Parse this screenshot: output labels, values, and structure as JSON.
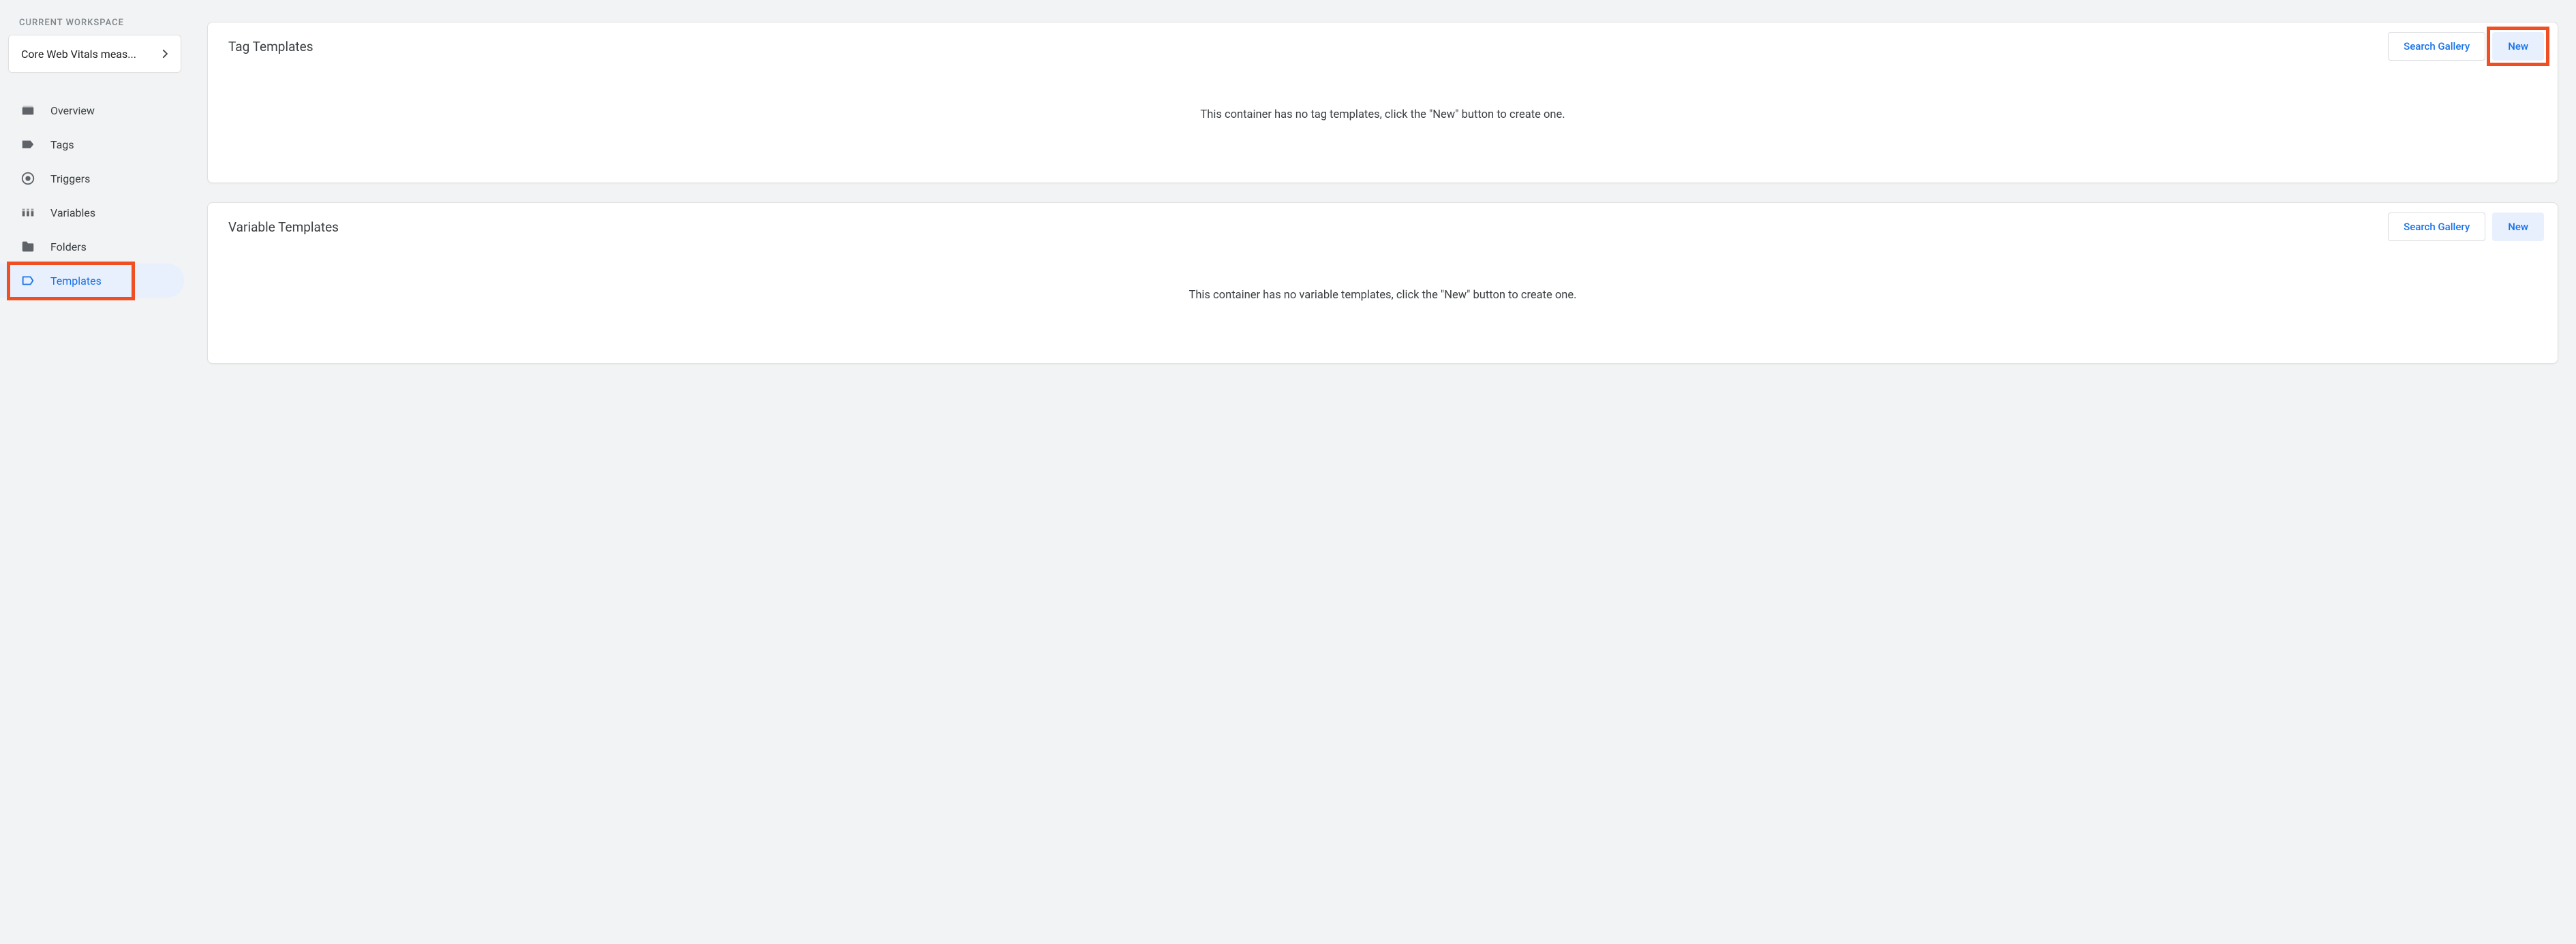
{
  "sidebar": {
    "workspace_heading": "CURRENT WORKSPACE",
    "workspace_name": "Core Web Vitals meas...",
    "items": [
      {
        "label": "Overview"
      },
      {
        "label": "Tags"
      },
      {
        "label": "Triggers"
      },
      {
        "label": "Variables"
      },
      {
        "label": "Folders"
      },
      {
        "label": "Templates"
      }
    ]
  },
  "cards": {
    "tag_templates": {
      "title": "Tag Templates",
      "search_gallery": "Search Gallery",
      "new": "New",
      "empty_text": "This container has no tag templates, click the \"New\" button to create one."
    },
    "variable_templates": {
      "title": "Variable Templates",
      "search_gallery": "Search Gallery",
      "new": "New",
      "empty_text": "This container has no variable templates, click the \"New\" button to create one."
    }
  }
}
